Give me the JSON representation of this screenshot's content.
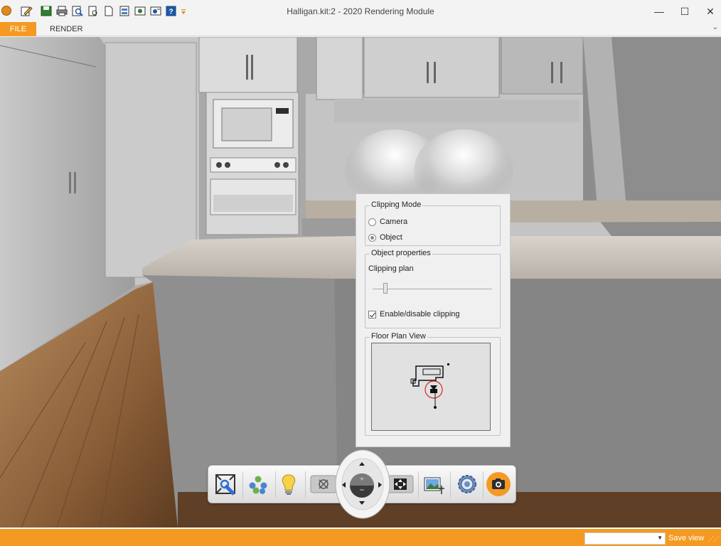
{
  "window": {
    "title": "Halligan.kit:2 - 2020 Rendering Module",
    "minimize_glyph": "—",
    "maximize_glyph": "☐",
    "close_glyph": "✕"
  },
  "quick_access": {
    "icons": [
      "edit-icon",
      "save-icon",
      "print-icon",
      "print-preview-icon",
      "open-document-icon",
      "new-document-icon",
      "catalog-icon",
      "settings-doc-icon",
      "export-icon",
      "help-icon",
      "customize-dropdown-icon"
    ]
  },
  "ribbon": {
    "tabs": [
      {
        "label": "FILE",
        "active": true
      },
      {
        "label": "RENDER",
        "active": false
      }
    ],
    "collapse_glyph": "⌄"
  },
  "clipping_panel": {
    "mode_group_title": "Clipping Mode",
    "mode_options": [
      {
        "label": "Camera",
        "checked": false
      },
      {
        "label": "Object",
        "checked": true
      }
    ],
    "object_group_title": "Object properties",
    "clipping_plan_label": "Clipping plan",
    "slider_value": 0.11,
    "enable_label": "Enable/disable clipping",
    "enable_checked": true,
    "floor_plan_title": "Floor Plan View"
  },
  "toolbar": {
    "buttons": [
      "fit-view-icon",
      "materials-icon",
      "lighting-icon",
      "reset-navigation-icon",
      "fullscreen-icon",
      "image-settings-icon",
      "settings-gear-icon",
      "camera-snapshot-icon"
    ],
    "nav_icons": [
      "nav-up-icon",
      "nav-down-icon",
      "nav-left-icon",
      "nav-right-icon",
      "zoom-plus-icon",
      "zoom-minus-icon"
    ]
  },
  "statusbar": {
    "view_select_value": "",
    "save_view_label": "Save view"
  },
  "colors": {
    "accent": "#f49a23",
    "panel_bg": "#f0f0f0"
  }
}
